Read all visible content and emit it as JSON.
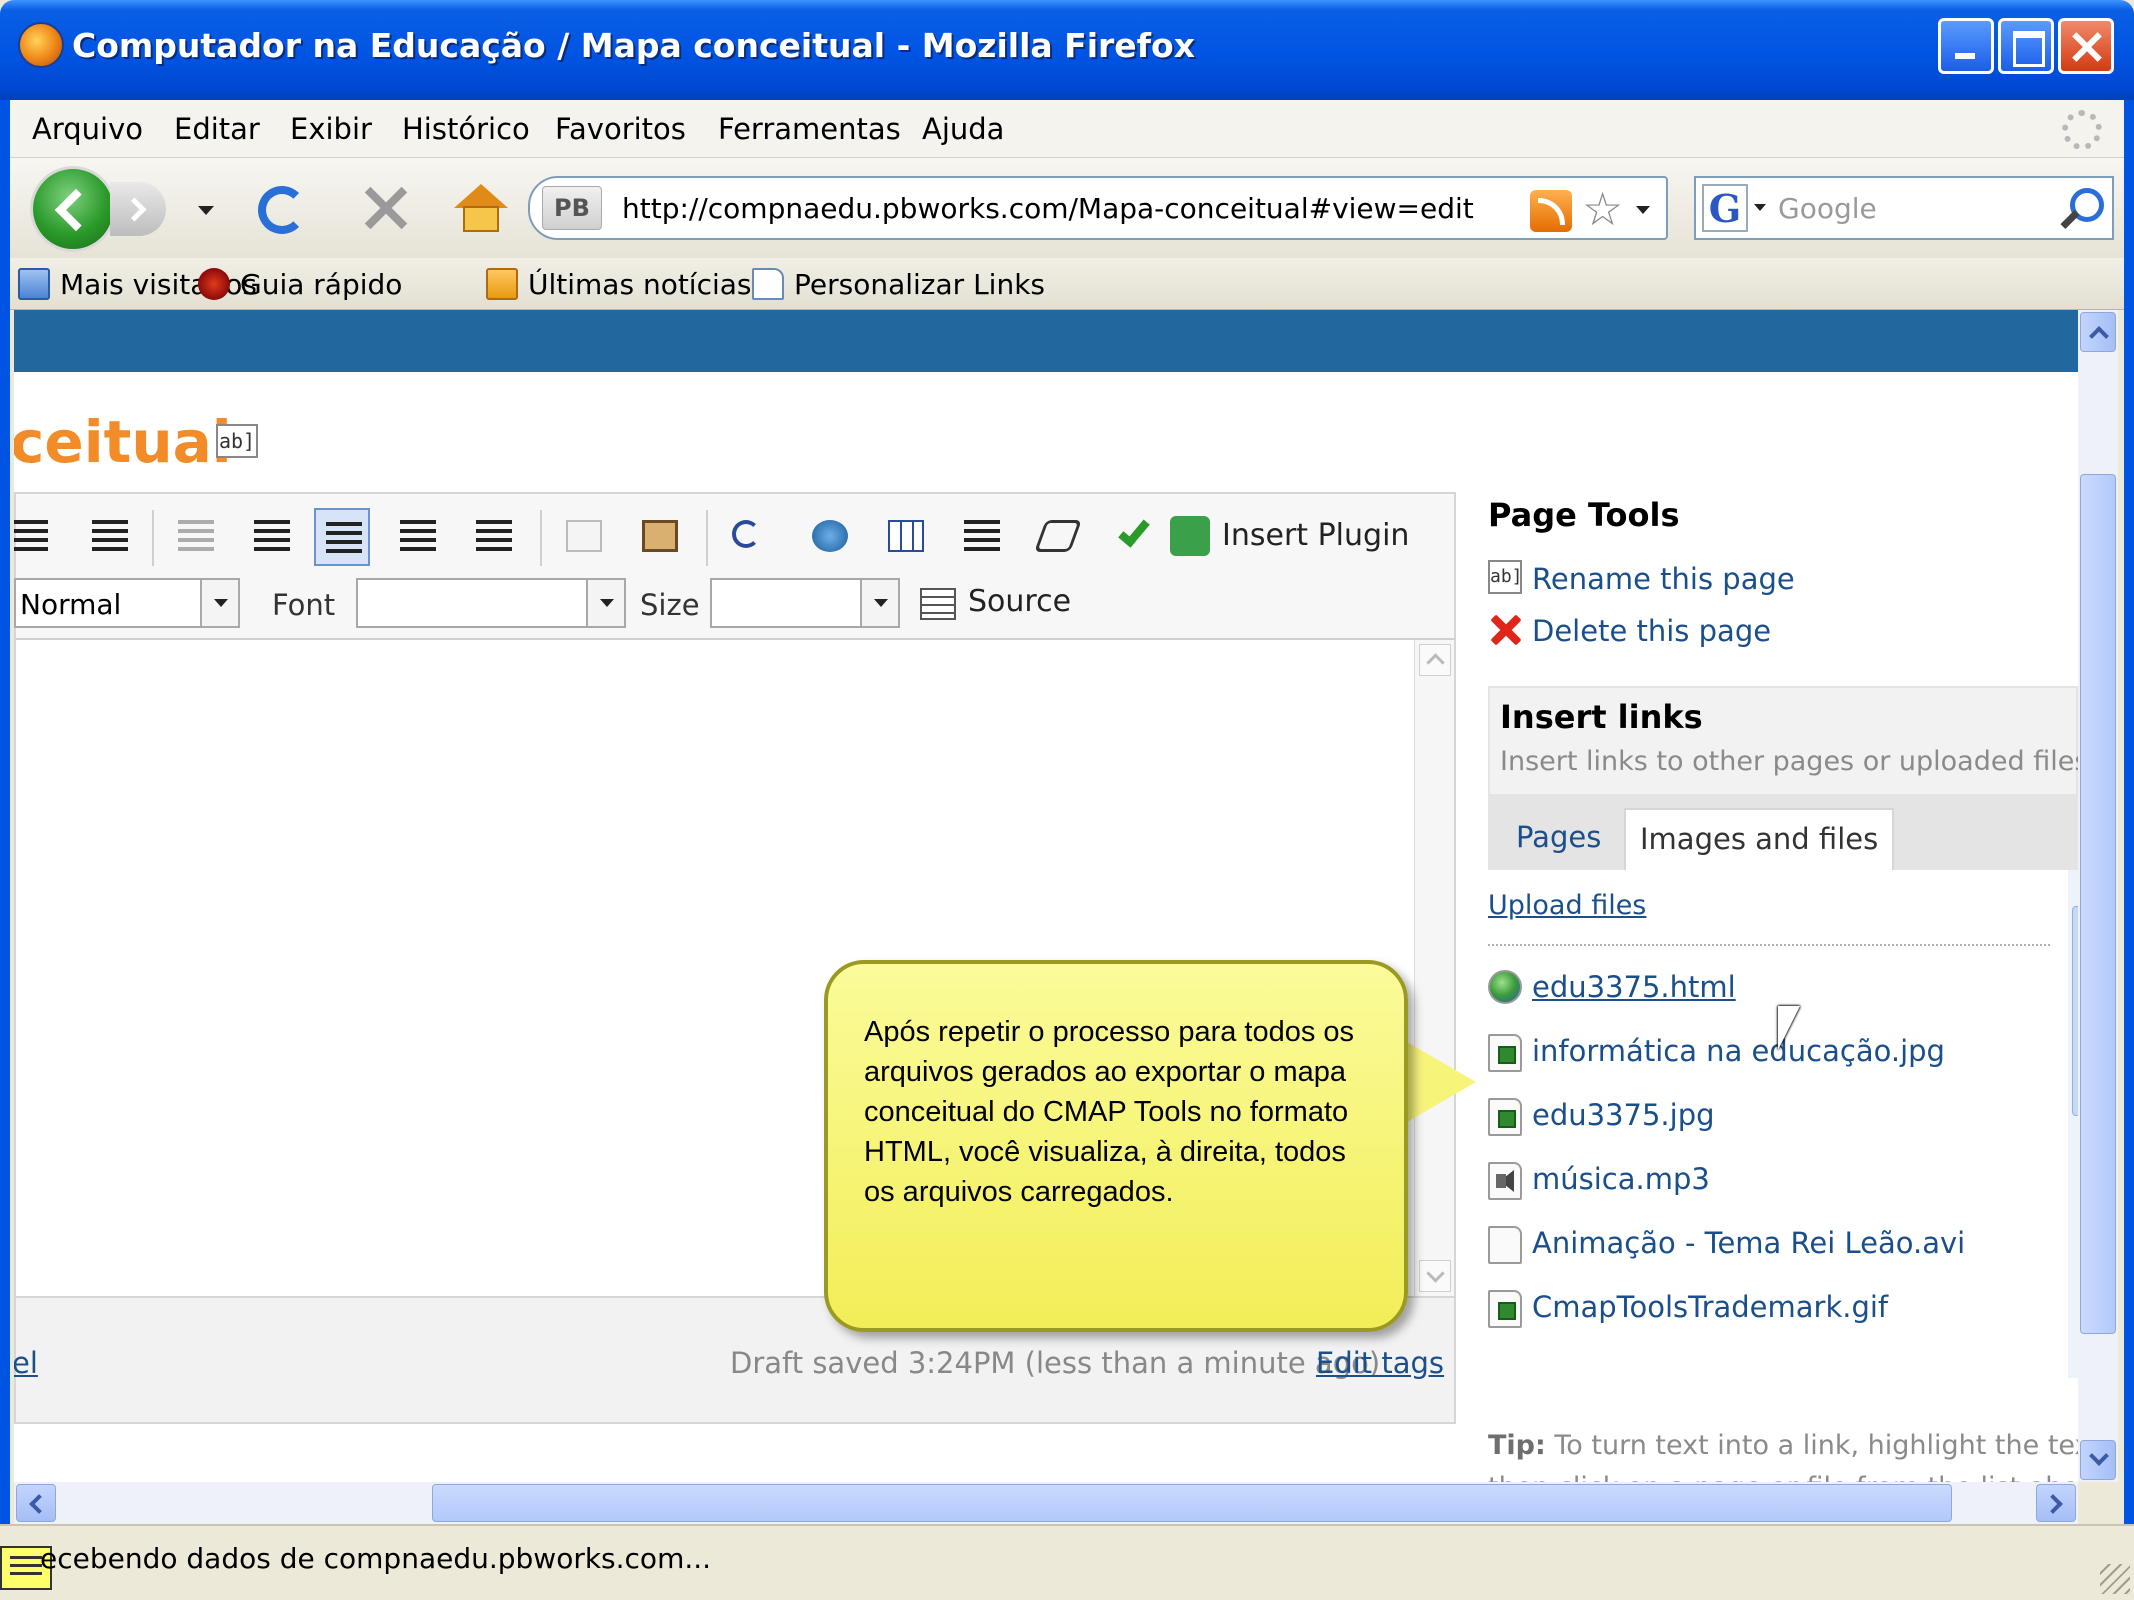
{
  "window": {
    "title": "Computador na Educação / Mapa conceitual - Mozilla Firefox"
  },
  "menu": [
    "Arquivo",
    "Editar",
    "Exibir",
    "Histórico",
    "Favoritos",
    "Ferramentas",
    "Ajuda"
  ],
  "navigation": {
    "site_badge": "PB",
    "url": "http://compnaedu.pbworks.com/Mapa-conceitual#view=edit",
    "search_placeholder": "Google",
    "search_engine_icon": "G"
  },
  "bookmarks": [
    "Mais visitados",
    "Guia rápido",
    "Últimas notícias",
    "Personalizar Links"
  ],
  "page": {
    "title": "ceitual",
    "rename_badge": "ab]"
  },
  "editor": {
    "insert_plugin": "Insert Plugin",
    "format_value": "Normal",
    "font_label": "Font",
    "font_value": "",
    "size_label": "Size",
    "size_value": "",
    "source_label": "Source",
    "cancel_link": "el",
    "draft_status": "Draft saved 3:24PM (less than a minute ago)",
    "edit_tags": "Edit tags"
  },
  "sidebar": {
    "heading": "Page Tools",
    "rename": "Rename this page",
    "delete": "Delete this page",
    "insert_links_title": "Insert links",
    "insert_links_desc": "Insert links to other pages or uploaded files.",
    "tabs": [
      "Pages",
      "Images and files"
    ],
    "active_tab": "Images and files",
    "upload": "Upload files",
    "files": [
      {
        "name": "edu3375.html",
        "type": "web"
      },
      {
        "name": "informática na educação.jpg",
        "type": "image"
      },
      {
        "name": "edu3375.jpg",
        "type": "image"
      },
      {
        "name": "música.mp3",
        "type": "audio"
      },
      {
        "name": "Animação - Tema Rei Leão.avi",
        "type": "file"
      },
      {
        "name": "CmapToolsTrademark.gif",
        "type": "image"
      }
    ],
    "tip_label": "Tip:",
    "tip_text": "To turn text into a link, highlight the text,",
    "tip_text2": "then click on a page or file from the list above"
  },
  "callout": {
    "text": "Após repetir o processo para todos os arquivos gerados ao exportar o mapa conceitual do CMAP Tools no formato HTML, você visualiza, à direita, todos os arquivos carregados."
  },
  "status": {
    "text": "ecebendo dados de compnaedu.pbworks.com..."
  }
}
